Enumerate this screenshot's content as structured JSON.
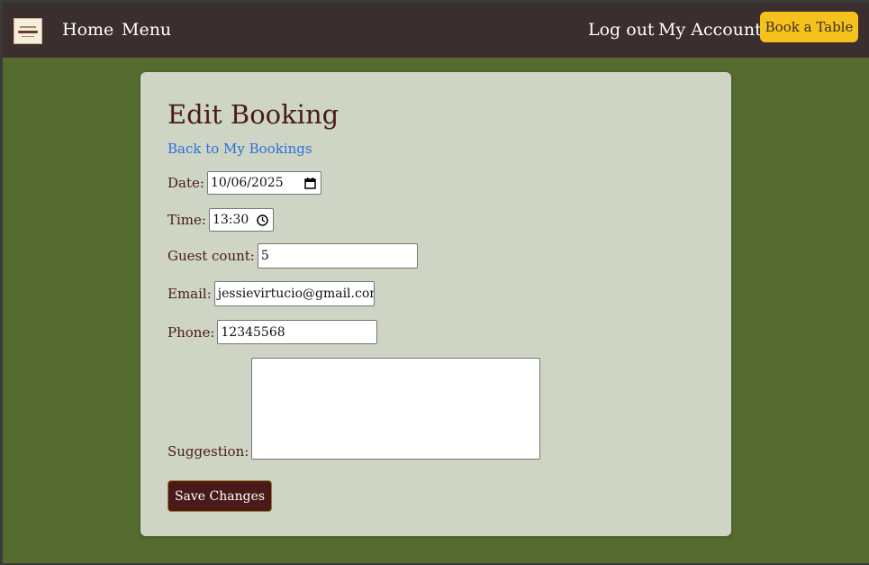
{
  "nav": {
    "logo": "restaurant-logo",
    "home": "Home",
    "menu": "Menu",
    "logout": "Log out",
    "account": "My Account",
    "book": "Book a Table"
  },
  "form": {
    "title": "Edit Booking",
    "back_link": "Back to My Bookings",
    "date_label": "Date:",
    "date_value": "10/06/2025",
    "time_label": "Time:",
    "time_value": "13:30",
    "guest_label": "Guest count:",
    "guest_value": "5",
    "email_label": "Email:",
    "email_value": "jessievirtucio@gmail.com",
    "phone_label": "Phone:",
    "phone_value": "12345568",
    "suggestion_label": "Suggestion:",
    "suggestion_value": "",
    "save": "Save Changes"
  },
  "colors": {
    "navbar": "#3b2e2e",
    "page_bg": "#556b2f",
    "card_bg": "#ced5c4",
    "accent": "#f4c21a",
    "button": "#4a1a1a",
    "link": "#2a6fdb"
  },
  "icons": {
    "date": "calendar-icon",
    "time": "clock-icon"
  }
}
